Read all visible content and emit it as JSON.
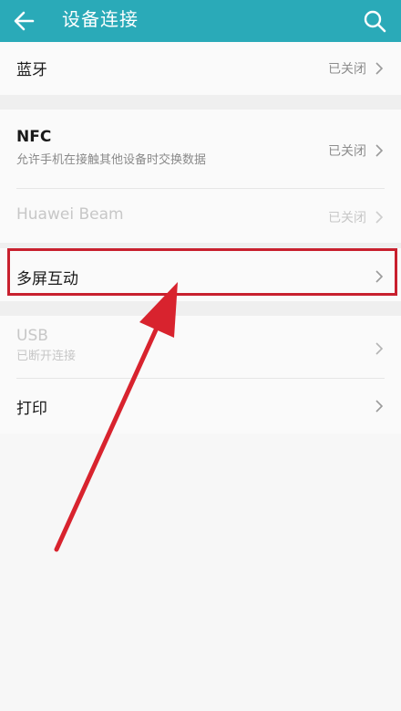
{
  "header": {
    "title": "设备连接",
    "back_icon": "back-arrow-icon",
    "search_icon": "search-icon"
  },
  "rows": {
    "bluetooth": {
      "label": "蓝牙",
      "status": "已关闭"
    },
    "nfc": {
      "label": "NFC",
      "description": "允许手机在接触其他设备时交换数据",
      "status": "已关闭"
    },
    "huawei_beam": {
      "label": "Huawei Beam",
      "status": "已关闭"
    },
    "multiscreen": {
      "label": "多屏互动"
    },
    "usb": {
      "label": "USB",
      "description": "已断开连接"
    },
    "print": {
      "label": "打印"
    }
  },
  "colors": {
    "header": "#2aaab8",
    "highlight": "#c8202e"
  }
}
